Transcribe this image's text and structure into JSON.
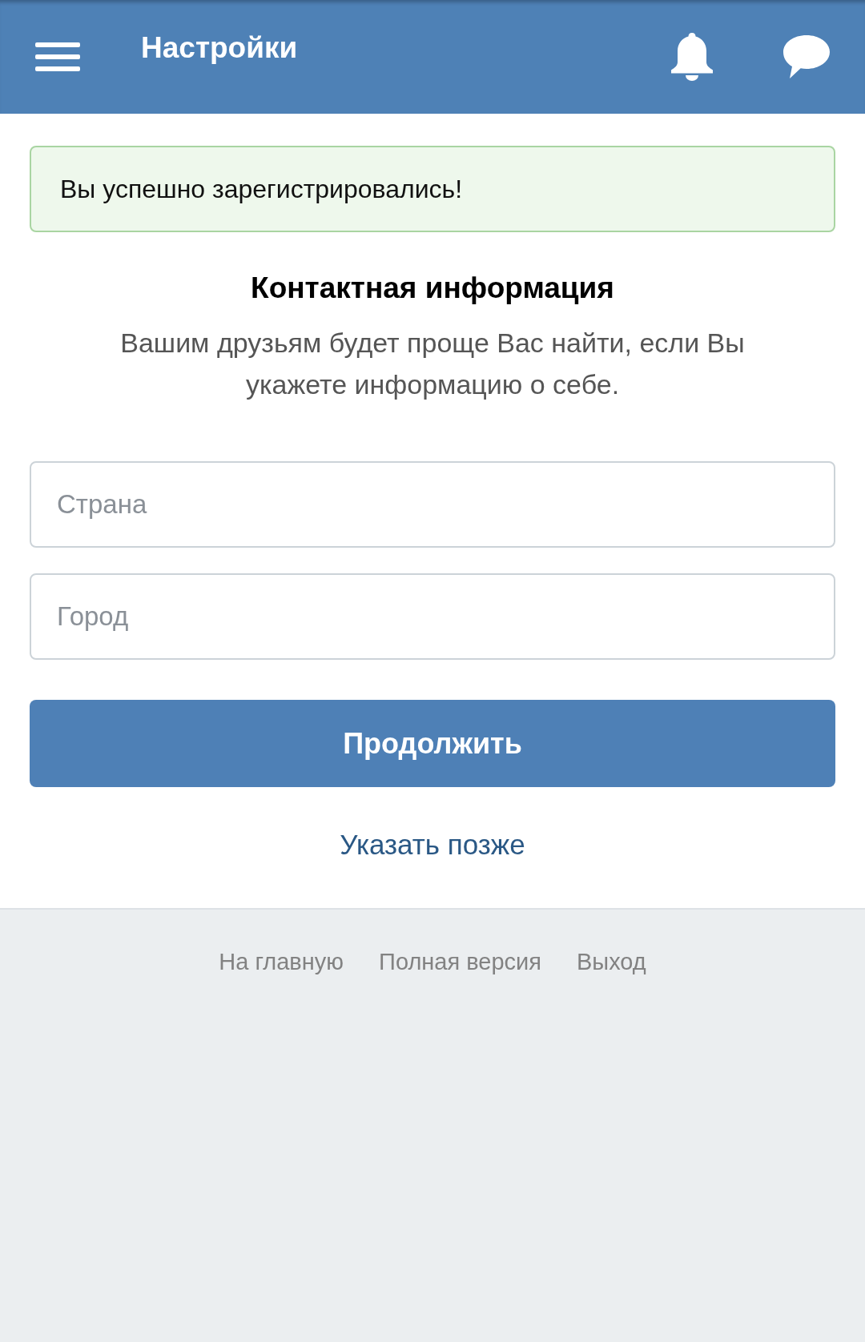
{
  "header": {
    "title": "Настройки"
  },
  "alert": {
    "text": "Вы успешно зарегистрировались!"
  },
  "section": {
    "title": "Контактная информация",
    "description": "Вашим друзьям будет проще Вас найти, если Вы укажете информацию о себе."
  },
  "fields": [
    {
      "placeholder": "Страна"
    },
    {
      "placeholder": "Город"
    }
  ],
  "primary_button": {
    "label": "Продолжить"
  },
  "skip_link": {
    "label": "Указать позже"
  },
  "footer_links": [
    "На главную",
    "Полная версия",
    "Выход"
  ]
}
